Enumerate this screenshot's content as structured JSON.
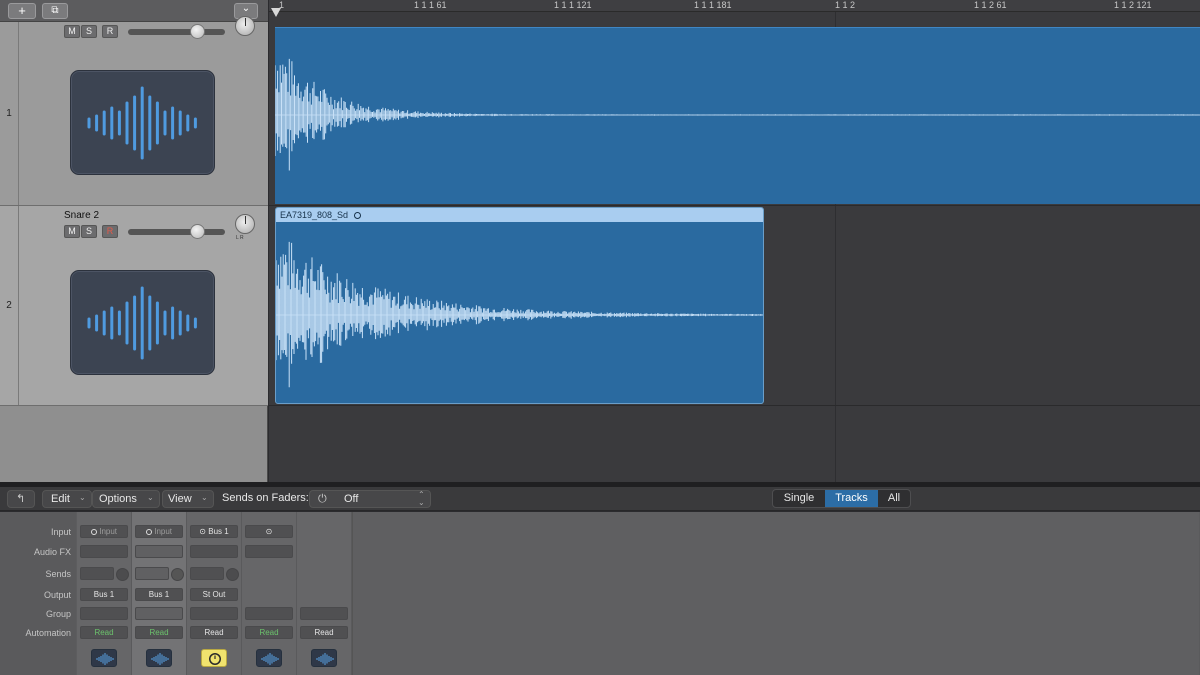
{
  "ruler": {
    "labels": [
      "1",
      "1 1 1 61",
      "1 1 1 121",
      "1 1 1 181",
      "1 1 2",
      "1 1 2 61",
      "1 1 2 121"
    ]
  },
  "toolbar": {
    "add_track_label": "+",
    "duplicate_track_label": "⧉",
    "collapse_label": "⌄"
  },
  "tracks": [
    {
      "number": "1",
      "name": "",
      "mute": "M",
      "solo": "S",
      "record": "R",
      "fader_level": 0.72,
      "pan_lr": "L  R"
    },
    {
      "number": "2",
      "name": "Snare 2",
      "mute": "M",
      "solo": "S",
      "record": "R",
      "fader_level": 0.72,
      "pan_lr": "L  R"
    }
  ],
  "regions": [
    {
      "name": "",
      "lane": 1
    },
    {
      "name": "EA7319_808_Sd",
      "lane": 2
    }
  ],
  "mixer_bar": {
    "back_icon": "↰",
    "edit": "Edit",
    "options": "Options",
    "view": "View",
    "sends_on_faders_label": "Sends on Faders:",
    "sends_on_faders_value": "Off",
    "chevron": "⌄",
    "updown": "⌃⌄",
    "power_icon": "⏻",
    "tabs": [
      "Single",
      "Tracks",
      "All"
    ],
    "active_tab": "Tracks"
  },
  "mixer_labels": [
    "Input",
    "Audio FX",
    "Sends",
    "Output",
    "Group",
    "Automation"
  ],
  "strips": [
    {
      "input": "Input",
      "output": "Bus 1",
      "automation": "Read",
      "automation_color": "green"
    },
    {
      "input": "Input",
      "output": "Bus 1",
      "automation": "Read",
      "automation_color": "green"
    },
    {
      "input": "Bus 1",
      "output": "St Out",
      "automation": "Read",
      "automation_color": "white"
    },
    {
      "input": "",
      "output": "",
      "automation": "Read",
      "automation_color": "green"
    },
    {
      "input": "",
      "output": "",
      "automation": "Read",
      "automation_color": "white"
    }
  ],
  "colors": {
    "region_blue": "#2a6aa0",
    "waveform": "#c9e1f7",
    "selected_tab": "#2c6da6",
    "read_green": "#6cc26c"
  }
}
